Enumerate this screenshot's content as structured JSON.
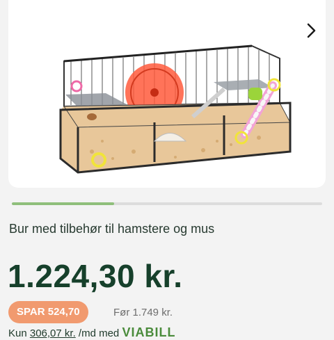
{
  "gallery": {
    "image_alt": "Hamsterbur med tilbehør",
    "next_icon": "chevron-right-icon",
    "progress_fraction": 0.33
  },
  "product": {
    "title": "Bur med tilbehør til hamstere og mus",
    "price": "1.224,30 kr.",
    "save_badge": "SPAR 524,70",
    "before_price": "Før 1.749 kr.",
    "installment_prefix": "Kun ",
    "installment_amount": "306,07 kr.",
    "installment_mid": " /md med ",
    "installment_brand": "VIABILL"
  },
  "colors": {
    "price": "#16402b",
    "save_badge_bg": "#f19a6f",
    "progress_fill": "#8fbf7b",
    "brand": "#4a8b3b"
  }
}
